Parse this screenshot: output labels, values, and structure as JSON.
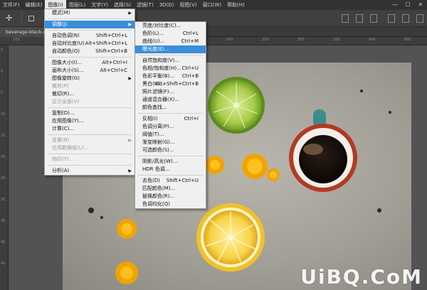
{
  "menubar": {
    "items": [
      "文件(F)",
      "编辑(E)",
      "图像(I)",
      "图层(L)",
      "文字(Y)",
      "选择(S)",
      "滤镜(T)",
      "3D(D)",
      "视图(V)",
      "窗口(W)",
      "帮助(H)"
    ],
    "active_index": 2
  },
  "window_controls": [
    "—",
    "☐",
    "✕"
  ],
  "document_tab": "beverage-black-c",
  "ruler_top_ticks": [
    "100",
    "50",
    "0",
    "50",
    "100",
    "150",
    "200",
    "250",
    "300",
    "350",
    "400",
    "450"
  ],
  "ruler_left_ticks": [
    "5",
    "0",
    "5",
    "10",
    "15",
    "20",
    "25",
    "30",
    "35",
    "40",
    "45"
  ],
  "image_menu": {
    "items": [
      {
        "label": "模式(M)",
        "shortcut": "",
        "submenu": true,
        "disabled": false
      },
      {
        "sep": true
      },
      {
        "label": "调整(J)",
        "shortcut": "",
        "submenu": true,
        "disabled": false,
        "highlight": true
      },
      {
        "sep": true
      },
      {
        "label": "自动色调(N)",
        "shortcut": "Shift+Ctrl+L",
        "disabled": false
      },
      {
        "label": "自动对比度(U)",
        "shortcut": "Alt+Shift+Ctrl+L",
        "disabled": false
      },
      {
        "label": "自动颜色(O)",
        "shortcut": "Shift+Ctrl+B",
        "disabled": false
      },
      {
        "sep": true
      },
      {
        "label": "图像大小(I)...",
        "shortcut": "Alt+Ctrl+I",
        "disabled": false
      },
      {
        "label": "画布大小(S)...",
        "shortcut": "Alt+Ctrl+C",
        "disabled": false
      },
      {
        "label": "图像旋转(G)",
        "shortcut": "",
        "submenu": true,
        "disabled": false
      },
      {
        "label": "裁剪(P)",
        "shortcut": "",
        "disabled": true
      },
      {
        "label": "裁切(R)...",
        "shortcut": "",
        "disabled": false
      },
      {
        "label": "显示全部(V)",
        "shortcut": "",
        "disabled": true
      },
      {
        "sep": true
      },
      {
        "label": "复制(D)...",
        "shortcut": "",
        "disabled": false
      },
      {
        "label": "应用图像(Y)...",
        "shortcut": "",
        "disabled": false
      },
      {
        "label": "计算(C)...",
        "shortcut": "",
        "disabled": false
      },
      {
        "sep": true
      },
      {
        "label": "变量(B)",
        "shortcut": "",
        "submenu": true,
        "disabled": true
      },
      {
        "label": "应用数据组(L)...",
        "shortcut": "",
        "disabled": true
      },
      {
        "sep": true
      },
      {
        "label": "陷印(T)...",
        "shortcut": "",
        "disabled": true
      },
      {
        "sep": true
      },
      {
        "label": "分析(A)",
        "shortcut": "",
        "submenu": true,
        "disabled": false
      }
    ]
  },
  "adjust_menu": {
    "items": [
      {
        "label": "亮度/对比度(C)...",
        "shortcut": ""
      },
      {
        "label": "色阶(L)...",
        "shortcut": "Ctrl+L"
      },
      {
        "label": "曲线(U)...",
        "shortcut": "Ctrl+M"
      },
      {
        "label": "曝光度(E)...",
        "shortcut": "",
        "highlight": true
      },
      {
        "sep": true
      },
      {
        "label": "自然饱和度(V)...",
        "shortcut": ""
      },
      {
        "label": "色相/饱和度(H)...",
        "shortcut": "Ctrl+U"
      },
      {
        "label": "色彩平衡(B)...",
        "shortcut": "Ctrl+B"
      },
      {
        "label": "黑白(K)...",
        "shortcut": "Alt+Shift+Ctrl+B"
      },
      {
        "label": "照片滤镜(F)...",
        "shortcut": ""
      },
      {
        "label": "通道混合器(X)...",
        "shortcut": ""
      },
      {
        "label": "颜色查找...",
        "shortcut": ""
      },
      {
        "sep": true
      },
      {
        "label": "反相(I)",
        "shortcut": "Ctrl+I"
      },
      {
        "label": "色调分离(P)...",
        "shortcut": ""
      },
      {
        "label": "阈值(T)...",
        "shortcut": ""
      },
      {
        "label": "渐变映射(G)...",
        "shortcut": ""
      },
      {
        "label": "可选颜色(S)...",
        "shortcut": ""
      },
      {
        "sep": true
      },
      {
        "label": "阴影/高光(W)...",
        "shortcut": ""
      },
      {
        "label": "HDR 色调...",
        "shortcut": ""
      },
      {
        "sep": true
      },
      {
        "label": "去色(D)",
        "shortcut": "Shift+Ctrl+U"
      },
      {
        "label": "匹配颜色(M)...",
        "shortcut": ""
      },
      {
        "label": "替换颜色(R)...",
        "shortcut": ""
      },
      {
        "label": "色调均化(Q)",
        "shortcut": ""
      }
    ]
  },
  "watermark": "UiBQ.CoM",
  "colors": {
    "menubar_bg": "#323232",
    "menu_bg": "#f0f0f0",
    "highlight": "#3a8fd8",
    "photo_bg": "#a9a69e",
    "lime": "#8cbc3a",
    "lemon": "#f2c62e",
    "cup_red": "#b23a22",
    "cup_teal": "#3d8c8e",
    "dandelion": "#f0a400"
  }
}
